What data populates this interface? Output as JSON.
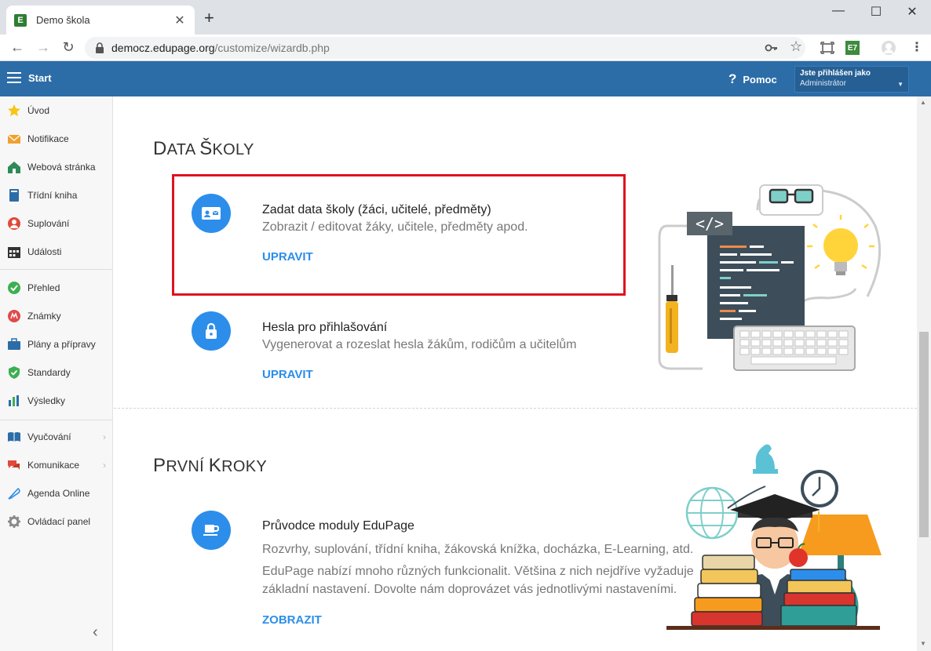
{
  "browser": {
    "tab_title": "Demo škola",
    "favicon_letter": "E",
    "url_host": "democz.edupage.org",
    "url_path": "/customize/wizardb.php",
    "extension_label": "E7"
  },
  "header": {
    "app_title": "Start",
    "help_label": "Pomoc",
    "user_line1": "Jste přihlášen jako",
    "user_line2": "Administrátor"
  },
  "sidebar": {
    "items": [
      {
        "label": "Úvod",
        "icon": "star-icon"
      },
      {
        "label": "Notifikace",
        "icon": "envelope-icon"
      },
      {
        "label": "Webová stránka",
        "icon": "house-icon"
      },
      {
        "label": "Třídní kniha",
        "icon": "book-icon"
      },
      {
        "label": "Suplování",
        "icon": "substitute-person-icon"
      },
      {
        "label": "Události",
        "icon": "calendar-icon"
      },
      {
        "label": "Přehled",
        "icon": "check-circle-icon"
      },
      {
        "label": "Známky",
        "icon": "grades-icon"
      },
      {
        "label": "Plány a přípravy",
        "icon": "briefcase-icon"
      },
      {
        "label": "Standardy",
        "icon": "shield-check-icon"
      },
      {
        "label": "Výsledky",
        "icon": "bar-chart-icon"
      },
      {
        "label": "Vyučování",
        "icon": "open-book-icon"
      },
      {
        "label": "Komunikace",
        "icon": "chat-icon"
      },
      {
        "label": "Agenda Online",
        "icon": "feather-icon"
      },
      {
        "label": "Ovládací panel",
        "icon": "gear-icon"
      }
    ]
  },
  "sections": {
    "data": {
      "title_first": "D",
      "title_rest": "ATA ",
      "title_second": "Š",
      "title_rest2": "KOLY",
      "item1": {
        "title": "Zadat data školy (žáci, učitelé, předměty)",
        "desc": "Zobrazit / editovat žáky, učitele, předměty apod.",
        "link": "UPRAVIT"
      },
      "item2": {
        "title": "Hesla pro přihlašování",
        "desc": "Vygenerovat a rozeslat hesla žákům, rodičům a učitelům",
        "link": "UPRAVIT"
      }
    },
    "first_steps": {
      "title_first": "P",
      "title_rest": "RVNÍ ",
      "title_second": "K",
      "title_rest2": "ROKY",
      "item1": {
        "title": "Průvodce moduly EduPage",
        "desc1": "Rozvrhy, suplování, třídní kniha, žákovská knížka, docházka, E-Learning, atd.",
        "desc2": "EduPage nabízí mnoho různých funkcionalit. Většina z nich nejdříve vyžaduje základní nastavení. Dovolte nám doprovázet vás jednotlivými nastaveními.",
        "link": "ZOBRAZIT"
      }
    }
  },
  "illustration": {
    "code_tag": "</>"
  }
}
